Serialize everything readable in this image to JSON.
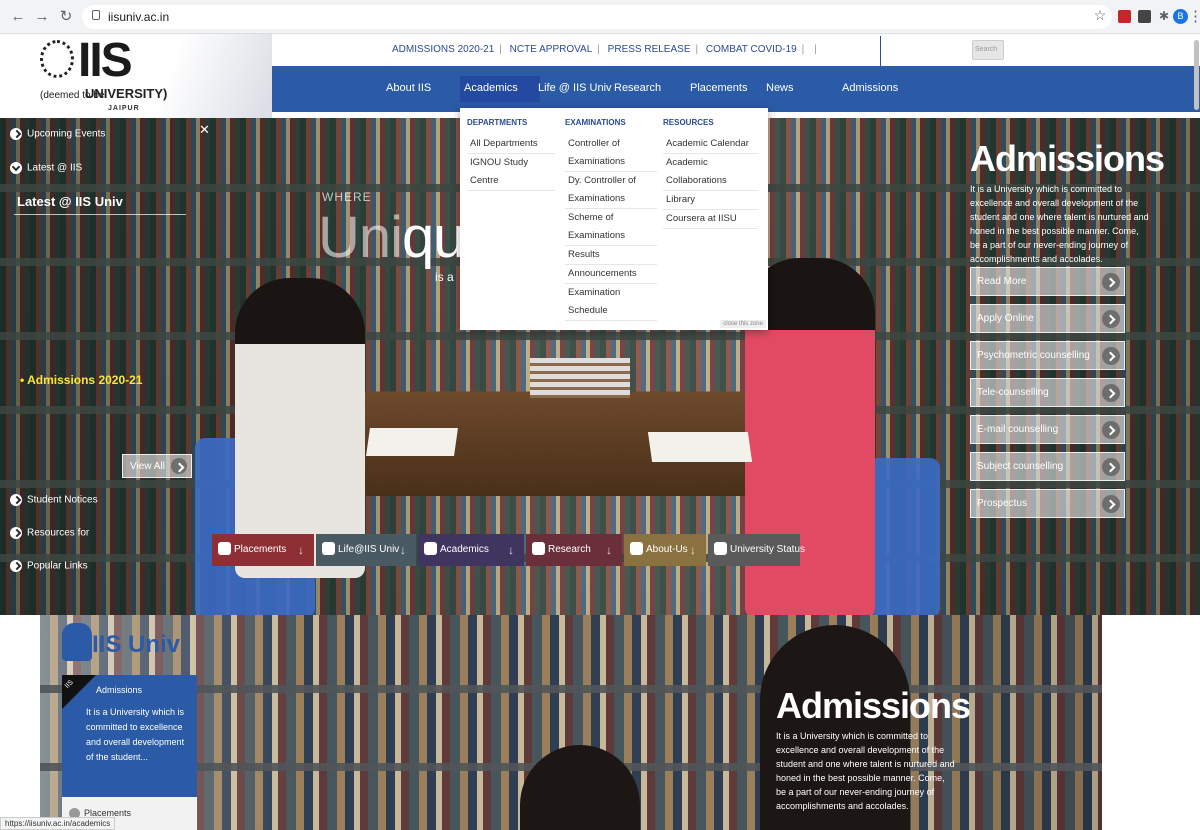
{
  "browser": {
    "url": "iisuniv.ac.in",
    "profile_initial": "B",
    "status_url": "https://iisuniv.ac.in/academics"
  },
  "logo": {
    "text": "IIS",
    "sub_prefix": "(deemed to be",
    "sub_main": "UNIVERSITY)",
    "city": "JAIPUR"
  },
  "topbar": {
    "links": [
      "ADMISSIONS 2020-21",
      "NCTE APPROVAL",
      "PRESS RELEASE",
      "COMBAT COVID-19"
    ],
    "search_placeholder": "Search"
  },
  "navbar": {
    "items": [
      "About IIS",
      "Academics",
      "Life @ IIS Univ",
      "Research",
      "Placements",
      "News",
      "Admissions"
    ]
  },
  "dropdown": {
    "departments": {
      "heading": "DEPARTMENTS",
      "items": [
        "All Departments",
        "IGNOU Study Centre"
      ]
    },
    "examinations": {
      "heading": "EXAMINATIONS",
      "items": [
        "Controller of Examinations",
        "Dy. Controller of Examinations",
        "Scheme of Examinations",
        "Results",
        "Announcements",
        "Examination Schedule"
      ]
    },
    "resources": {
      "heading": "RESOURCES",
      "items": [
        "Academic Calendar",
        "Academic Collaborations",
        "Library",
        "Coursera at IISU"
      ]
    },
    "close_label": "close this zone"
  },
  "hero": {
    "where": "WHERE",
    "uni_dim": "Uni",
    "uni_bright": "qu",
    "isa": "is a"
  },
  "left_panel": {
    "upcoming": "Upcoming Events",
    "latest_at": "Latest @ IIS",
    "latest_title": "Latest @ IIS Univ",
    "admissions_link": "Admissions 2020-21",
    "view_all": "View All",
    "student_notices": "Student Notices",
    "resources_for": "Resources for",
    "popular_links": "Popular Links"
  },
  "admissions_panel": {
    "title": "Admissions",
    "description": "It is a University which is committed to excellence and overall development of the student and one where talent is nurtured and honed in the best possible manner. Come, be a part of our never-ending journey of accomplishments and accolades.",
    "buttons": [
      "Read More",
      "Apply Online",
      "Psychometric counselling",
      "Tele-counselling",
      "E-mail counselling",
      "Subject counselling",
      "Prospectus"
    ]
  },
  "quick_tabs": [
    {
      "label": "Placements",
      "icon": "handshake-icon",
      "color": "#8e2f36"
    },
    {
      "label": "Life@IIS Univ",
      "icon": "mask-icon",
      "color": "#4a5a63"
    },
    {
      "label": "Academics",
      "icon": "book-icon",
      "color": "#40355f"
    },
    {
      "label": "Research",
      "icon": "hourglass-icon",
      "color": "#6a2f3a"
    },
    {
      "label": "About-Us",
      "icon": "info-icon",
      "color": "#8a7240"
    },
    {
      "label": "University Status",
      "icon": "award-icon",
      "color": "#5a5a5a"
    }
  ],
  "lower": {
    "brand": "IIS Univ",
    "card_badge": "IIS",
    "card_title": "Admissions",
    "card_body": "It is a University which is committed to excellence and overall development of the student...",
    "footer_link": "Placements",
    "title": "Admissions",
    "description": "It is a University which is committed to excellence and overall development of the student and one where talent is nurtured and honed in the best possible manner. Come, be a part of our never-ending journey of accomplishments and accolades."
  },
  "colors": {
    "nav_blue": "#2b5aa7",
    "link_blue": "#2b4a9a",
    "highlight_yellow": "#ffe23a"
  }
}
